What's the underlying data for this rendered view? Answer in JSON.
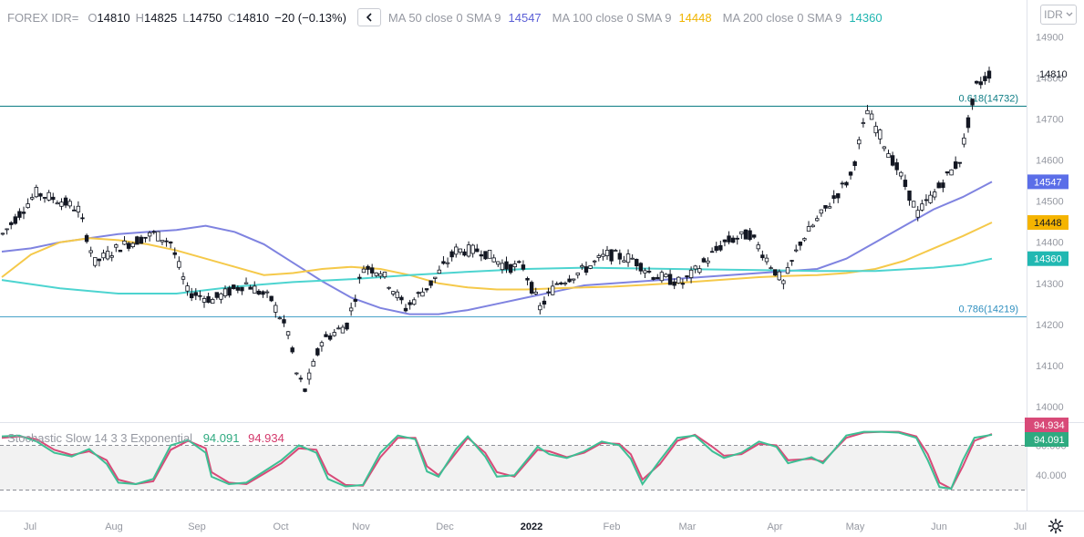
{
  "header": {
    "symbol": "FOREX IDR=",
    "open_key": "O",
    "open": "14810",
    "high_key": "H",
    "high": "14825",
    "low_key": "L",
    "low": "14750",
    "close_key": "C",
    "close": "14810",
    "change": "−20 (−0.13%)",
    "ma50_label": "MA 50 close 0 SMA 9",
    "ma50_value": "14547",
    "ma100_label": "MA 100 close 0 SMA 9",
    "ma100_value": "14448",
    "ma200_label": "MA 200 close 0 SMA 9",
    "ma200_value": "14360"
  },
  "currency_selector": "IDR",
  "stochastic": {
    "label": "Stochastic Slow 14 3 3 Exponential",
    "k_value": "94.091",
    "d_value": "94.934"
  },
  "colors": {
    "ma50": "#7f83e0",
    "ma100": "#f5c94a",
    "ma200": "#4dd4d0",
    "fib": "#0c7c84",
    "stoch_k": "#3dbf94",
    "stoch_d": "#d84a78",
    "candle": "#131722",
    "stoch_band": "#f2f2f2"
  },
  "chart_data": [
    {
      "type": "candlestick",
      "title": "FOREX IDR=",
      "y_ticks": [
        14000,
        14100,
        14200,
        14300,
        14400,
        14500,
        14600,
        14700,
        14800,
        14900
      ],
      "x_ticks": [
        "Jul",
        "Aug",
        "Sep",
        "Oct",
        "Nov",
        "Dec",
        "2022",
        "Feb",
        "Mar",
        "Apr",
        "May",
        "Jun",
        "Jul"
      ],
      "ylim": [
        13980,
        14945
      ],
      "last_price": "14810",
      "horizontal_levels": [
        {
          "label": "0.618(14732)",
          "value": 14732
        },
        {
          "label": "0.786(14219)",
          "value": 14219
        }
      ],
      "series": [
        {
          "name": "MA 50",
          "value_label": "14547",
          "points": [
            [
              0,
              14377
            ],
            [
              5,
              14385
            ],
            [
              10,
              14400
            ],
            [
              15,
              14410
            ],
            [
              20,
              14420
            ],
            [
              25,
              14425
            ],
            [
              30,
              14430
            ],
            [
              35,
              14440
            ],
            [
              40,
              14425
            ],
            [
              45,
              14395
            ],
            [
              50,
              14350
            ],
            [
              55,
              14305
            ],
            [
              60,
              14265
            ],
            [
              65,
              14240
            ],
            [
              70,
              14225
            ],
            [
              75,
              14225
            ],
            [
              80,
              14235
            ],
            [
              85,
              14250
            ],
            [
              90,
              14265
            ],
            [
              95,
              14280
            ],
            [
              100,
              14295
            ],
            [
              105,
              14300
            ],
            [
              110,
              14305
            ],
            [
              115,
              14310
            ],
            [
              120,
              14315
            ],
            [
              125,
              14320
            ],
            [
              130,
              14325
            ],
            [
              135,
              14330
            ],
            [
              140,
              14335
            ],
            [
              145,
              14360
            ],
            [
              150,
              14400
            ],
            [
              155,
              14440
            ],
            [
              160,
              14480
            ],
            [
              165,
              14510
            ],
            [
              170,
              14547
            ]
          ]
        },
        {
          "name": "MA 100",
          "value_label": "14448",
          "points": [
            [
              0,
              14315
            ],
            [
              5,
              14370
            ],
            [
              10,
              14400
            ],
            [
              15,
              14410
            ],
            [
              20,
              14405
            ],
            [
              25,
              14395
            ],
            [
              30,
              14380
            ],
            [
              35,
              14360
            ],
            [
              40,
              14340
            ],
            [
              45,
              14320
            ],
            [
              50,
              14325
            ],
            [
              55,
              14335
            ],
            [
              60,
              14340
            ],
            [
              65,
              14335
            ],
            [
              70,
              14320
            ],
            [
              75,
              14300
            ],
            [
              80,
              14290
            ],
            [
              85,
              14285
            ],
            [
              90,
              14285
            ],
            [
              95,
              14288
            ],
            [
              100,
              14290
            ],
            [
              105,
              14292
            ],
            [
              110,
              14296
            ],
            [
              115,
              14300
            ],
            [
              120,
              14305
            ],
            [
              125,
              14310
            ],
            [
              130,
              14315
            ],
            [
              135,
              14318
            ],
            [
              140,
              14320
            ],
            [
              145,
              14325
            ],
            [
              150,
              14335
            ],
            [
              155,
              14355
            ],
            [
              160,
              14385
            ],
            [
              165,
              14415
            ],
            [
              170,
              14448
            ]
          ]
        },
        {
          "name": "MA 200",
          "value_label": "14360",
          "points": [
            [
              0,
              14308
            ],
            [
              10,
              14288
            ],
            [
              20,
              14275
            ],
            [
              30,
              14275
            ],
            [
              40,
              14292
            ],
            [
              50,
              14303
            ],
            [
              60,
              14310
            ],
            [
              70,
              14320
            ],
            [
              80,
              14328
            ],
            [
              90,
              14335
            ],
            [
              100,
              14338
            ],
            [
              110,
              14336
            ],
            [
              120,
              14334
            ],
            [
              130,
              14332
            ],
            [
              140,
              14330
            ],
            [
              150,
              14330
            ],
            [
              160,
              14338
            ],
            [
              165,
              14345
            ],
            [
              170,
              14360
            ]
          ]
        }
      ]
    },
    {
      "type": "line",
      "title": "Stochastic Slow 14 3 3 Exponential",
      "y_ticks": [
        40.0,
        80.0
      ],
      "ylim": [
        0,
        100
      ],
      "bands": [
        20,
        80
      ],
      "series": [
        {
          "name": "K",
          "value_label": "94.091",
          "points": [
            [
              0,
              92
            ],
            [
              3,
              93
            ],
            [
              6,
              85
            ],
            [
              9,
              70
            ],
            [
              12,
              65
            ],
            [
              15,
              75
            ],
            [
              18,
              55
            ],
            [
              20,
              30
            ],
            [
              23,
              28
            ],
            [
              26,
              35
            ],
            [
              29,
              80
            ],
            [
              32,
              87
            ],
            [
              35,
              70
            ],
            [
              36,
              38
            ],
            [
              39,
              28
            ],
            [
              42,
              30
            ],
            [
              45,
              45
            ],
            [
              48,
              60
            ],
            [
              51,
              80
            ],
            [
              54,
              70
            ],
            [
              56,
              35
            ],
            [
              59,
              25
            ],
            [
              62,
              27
            ],
            [
              65,
              70
            ],
            [
              68,
              93
            ],
            [
              71,
              88
            ],
            [
              73,
              45
            ],
            [
              75,
              38
            ],
            [
              78,
              75
            ],
            [
              80,
              92
            ],
            [
              83,
              65
            ],
            [
              85,
              38
            ],
            [
              88,
              40
            ],
            [
              92,
              78
            ],
            [
              94,
              68
            ],
            [
              97,
              63
            ],
            [
              100,
              72
            ],
            [
              103,
              85
            ],
            [
              106,
              80
            ],
            [
              108,
              62
            ],
            [
              110,
              28
            ],
            [
              113,
              60
            ],
            [
              116,
              90
            ],
            [
              119,
              93
            ],
            [
              122,
              72
            ],
            [
              124,
              63
            ],
            [
              127,
              70
            ],
            [
              130,
              85
            ],
            [
              133,
              78
            ],
            [
              135,
              56
            ],
            [
              139,
              64
            ],
            [
              141,
              56
            ],
            [
              145,
              93
            ],
            [
              148,
              98
            ],
            [
              151,
              98
            ],
            [
              154,
              97
            ],
            [
              157,
              90
            ],
            [
              159,
              60
            ],
            [
              161,
              24
            ],
            [
              163,
              22
            ],
            [
              165,
              60
            ],
            [
              167,
              90
            ],
            [
              170,
              94
            ]
          ]
        },
        {
          "name": "D",
          "value_label": "94.934",
          "points": [
            [
              0,
              90
            ],
            [
              3,
              92
            ],
            [
              6,
              88
            ],
            [
              9,
              74
            ],
            [
              12,
              67
            ],
            [
              15,
              72
            ],
            [
              18,
              60
            ],
            [
              20,
              34
            ],
            [
              23,
              28
            ],
            [
              26,
              32
            ],
            [
              29,
              74
            ],
            [
              32,
              86
            ],
            [
              35,
              76
            ],
            [
              36,
              44
            ],
            [
              39,
              30
            ],
            [
              42,
              28
            ],
            [
              45,
              42
            ],
            [
              48,
              56
            ],
            [
              51,
              76
            ],
            [
              54,
              74
            ],
            [
              56,
              42
            ],
            [
              59,
              27
            ],
            [
              62,
              26
            ],
            [
              65,
              64
            ],
            [
              68,
              90
            ],
            [
              71,
              90
            ],
            [
              73,
              52
            ],
            [
              75,
              40
            ],
            [
              78,
              70
            ],
            [
              80,
              90
            ],
            [
              83,
              70
            ],
            [
              85,
              44
            ],
            [
              88,
              38
            ],
            [
              92,
              74
            ],
            [
              94,
              72
            ],
            [
              97,
              64
            ],
            [
              100,
              70
            ],
            [
              103,
              83
            ],
            [
              106,
              82
            ],
            [
              108,
              68
            ],
            [
              110,
              34
            ],
            [
              113,
              55
            ],
            [
              116,
              86
            ],
            [
              119,
              94
            ],
            [
              122,
              78
            ],
            [
              124,
              66
            ],
            [
              127,
              68
            ],
            [
              130,
              82
            ],
            [
              133,
              80
            ],
            [
              135,
              60
            ],
            [
              139,
              62
            ],
            [
              141,
              58
            ],
            [
              145,
              90
            ],
            [
              148,
              97
            ],
            [
              151,
              98
            ],
            [
              154,
              98
            ],
            [
              157,
              92
            ],
            [
              159,
              68
            ],
            [
              161,
              30
            ],
            [
              163,
              22
            ],
            [
              165,
              52
            ],
            [
              167,
              86
            ],
            [
              170,
              95
            ]
          ]
        }
      ]
    }
  ]
}
